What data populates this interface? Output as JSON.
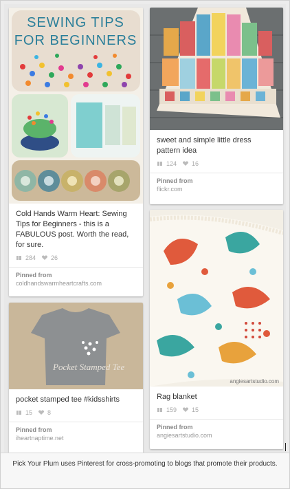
{
  "pins": [
    {
      "id": "sewing",
      "image_title": "SEWING TIPS FOR BEGINNERS",
      "description": "Cold Hands Warm Heart: Sewing Tips for Beginners - this is a FABULOUS post. Worth the read, for sure.",
      "repins": "284",
      "likes": "26",
      "pinned_from_label": "Pinned from",
      "source": "coldhandswarmheartcrafts.com"
    },
    {
      "id": "tee",
      "image_title": "Pocket Stamped Tee",
      "description": "pocket stamped tee #kidsshirts",
      "repins": "15",
      "likes": "8",
      "pinned_from_label": "Pinned from",
      "source": "iheartnaptime.net"
    },
    {
      "id": "dress",
      "description": "sweet and simple little dress pattern idea",
      "repins": "124",
      "likes": "16",
      "pinned_from_label": "Pinned from",
      "source": "flickr.com"
    },
    {
      "id": "blanket",
      "image_watermark": "angiesartstudio.com",
      "description": "Rag blanket",
      "repins": "159",
      "likes": "15",
      "pinned_from_label": "Pinned from",
      "source": "angiesartstudio.com"
    }
  ],
  "caption": "Pick Your Plum uses Pinterest for cross-promoting to blogs that promote their products.",
  "icons": {
    "repin": "repin-icon",
    "like": "heart-icon"
  },
  "colors": {
    "background": "#e8e8e8",
    "card": "#ffffff",
    "meta_text": "#aaaaaa"
  }
}
